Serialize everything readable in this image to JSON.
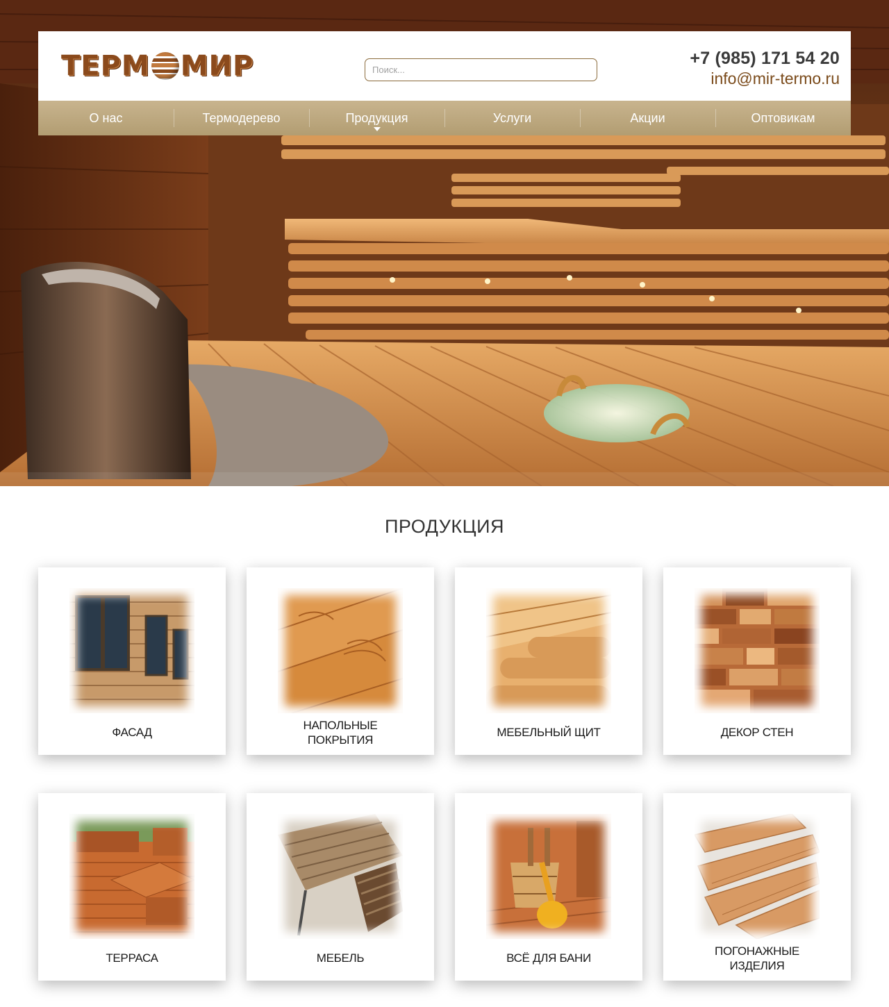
{
  "header": {
    "logo_text_left": "ТЕРМ",
    "logo_text_right": "МИР",
    "search_placeholder": "Поиск...",
    "phone": "+7 (985) 171 54 20",
    "email": "info@mir-termo.ru"
  },
  "nav": {
    "items": [
      {
        "label": "О нас"
      },
      {
        "label": "Термодерево"
      },
      {
        "label": "Продукция",
        "has_dropdown": true
      },
      {
        "label": "Услуги"
      },
      {
        "label": "Акции"
      },
      {
        "label": "Оптовикам"
      }
    ]
  },
  "hero": {
    "image": "sauna-interior-photo"
  },
  "products": {
    "title": "ПРОДУКЦИЯ",
    "items": [
      {
        "label": "ФАСАД",
        "image": "facade-photo"
      },
      {
        "label": "НАПОЛЬНЫЕ\nПОКРЫТИЯ",
        "image": "flooring-photo"
      },
      {
        "label": "МЕБЕЛЬНЫЙ ЩИТ",
        "image": "furniture-board-photo"
      },
      {
        "label": "ДЕКОР СТЕН",
        "image": "wall-decor-photo"
      },
      {
        "label": "ТЕРРАСА",
        "image": "terrace-photo"
      },
      {
        "label": "МЕБЕЛЬ",
        "image": "furniture-photo"
      },
      {
        "label": "ВСЁ ДЛЯ БАНИ",
        "image": "sauna-accessories-photo"
      },
      {
        "label": "ПОГОНАЖНЫЕ\nИЗДЕЛИЯ",
        "image": "moldings-photo"
      }
    ]
  },
  "colors": {
    "nav_background": "#b8a47c",
    "logo_brown": "#8b4a1c",
    "email": "#7a4a1a",
    "wood_light": "#e3a35e",
    "wood_dark": "#6e3919"
  }
}
